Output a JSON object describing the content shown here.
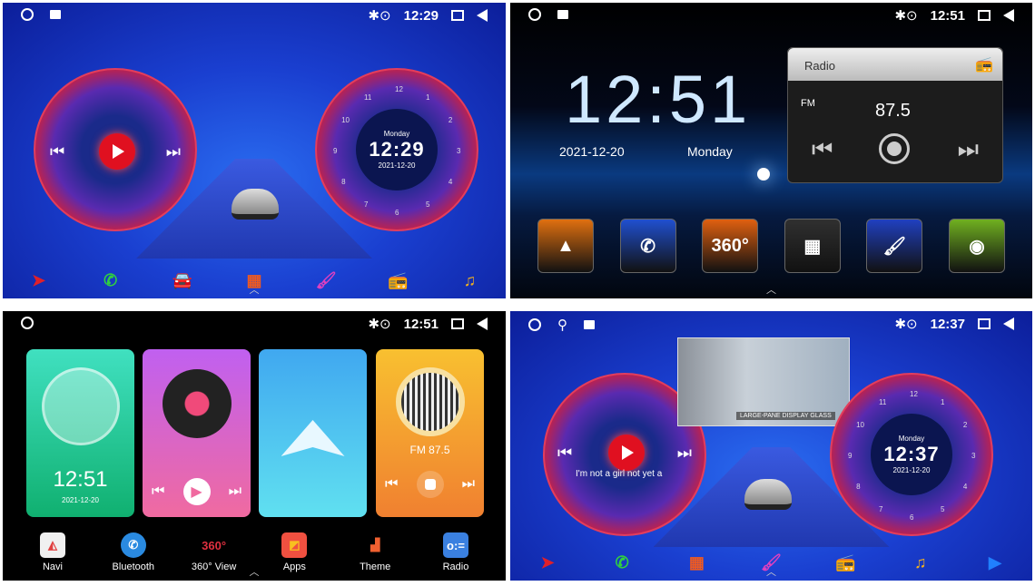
{
  "panel1": {
    "status": {
      "time": "12:29"
    },
    "clock": {
      "day": "Monday",
      "time": "12:29",
      "date": "2021-12-20",
      "dial": [
        "12",
        "1",
        "2",
        "3",
        "4",
        "5",
        "6",
        "7",
        "8",
        "9",
        "10",
        "11"
      ]
    },
    "dock": [
      {
        "icon": "navigation-arrow-icon",
        "color": "#e0202a",
        "glyph": "➤"
      },
      {
        "icon": "phone-icon",
        "color": "#30d040",
        "glyph": "✆"
      },
      {
        "icon": "car-360-icon",
        "color": "#f0a020",
        "glyph": "🚘"
      },
      {
        "icon": "apps-grid-icon",
        "color": "#f05a20",
        "glyph": "▦"
      },
      {
        "icon": "theme-brush-icon",
        "color": "#e040c0",
        "glyph": "🖌"
      },
      {
        "icon": "radio-icon",
        "color": "#40a0ff",
        "glyph": "📻"
      },
      {
        "icon": "music-note-icon",
        "color": "#f0b020",
        "glyph": "♫"
      }
    ]
  },
  "panel2": {
    "status": {
      "time": "12:51"
    },
    "clock": {
      "time": "12:51",
      "date": "2021-12-20",
      "day": "Monday"
    },
    "radio": {
      "title": "Radio",
      "band": "FM",
      "freq": "87.5"
    },
    "dock": [
      {
        "icon": "navigation-icon",
        "bg": "#e07010",
        "glyph": "▲"
      },
      {
        "icon": "bluetooth-phone-icon",
        "bg": "#2050d0",
        "glyph": "✆"
      },
      {
        "icon": "360-view-icon",
        "bg": "#e06010",
        "glyph": "360°"
      },
      {
        "icon": "apps-icon",
        "bg": "#303030",
        "glyph": "▦"
      },
      {
        "icon": "theme-icon",
        "bg": "#2040c0",
        "glyph": "🖌"
      },
      {
        "icon": "radio-signal-icon",
        "bg": "#70b020",
        "glyph": "◉"
      }
    ]
  },
  "panel3": {
    "status": {
      "time": "12:51"
    },
    "clock": {
      "time": "12:51",
      "date": "2021-12-20"
    },
    "radio": {
      "freq": "FM 87.5"
    },
    "dock": [
      {
        "label": "Navi",
        "icon": "navi-icon",
        "glyph": "◭",
        "bg": "#f0f0f0",
        "fg": "#e04040"
      },
      {
        "label": "Bluetooth",
        "icon": "bluetooth-icon",
        "glyph": "✆",
        "bg": "#2a8ae0",
        "fg": "#fff"
      },
      {
        "label": "360° View",
        "icon": "360-view-icon",
        "glyph": "360°",
        "bg": "transparent",
        "fg": "#e03040"
      },
      {
        "label": "Apps",
        "icon": "apps-icon",
        "glyph": "◩",
        "bg": "#f05040",
        "fg": "#f8c020"
      },
      {
        "label": "Theme",
        "icon": "theme-icon",
        "glyph": "▟",
        "bg": "transparent",
        "fg": "#f06030"
      },
      {
        "label": "Radio",
        "icon": "radio-icon",
        "glyph": "o:=",
        "bg": "#3a80e0",
        "fg": "#fff"
      }
    ]
  },
  "panel4": {
    "status": {
      "time": "12:37"
    },
    "clock": {
      "day": "Monday",
      "time": "12:37",
      "date": "2021-12-20",
      "dial": [
        "12",
        "1",
        "2",
        "3",
        "4",
        "5",
        "6",
        "7",
        "8",
        "9",
        "10",
        "11"
      ]
    },
    "lyrics": "I'm not a girl not yet a",
    "video_caption": "LARGE-PANE DISPLAY GLASS",
    "dock": [
      {
        "icon": "navigation-arrow-icon",
        "color": "#e0202a",
        "glyph": "➤"
      },
      {
        "icon": "phone-icon",
        "color": "#30d040",
        "glyph": "✆"
      },
      {
        "icon": "apps-grid-icon",
        "color": "#f05a20",
        "glyph": "▦"
      },
      {
        "icon": "theme-brush-icon",
        "color": "#e040c0",
        "glyph": "🖌"
      },
      {
        "icon": "radio-icon",
        "color": "#40a0ff",
        "glyph": "📻"
      },
      {
        "icon": "music-note-icon",
        "color": "#f0b020",
        "glyph": "♫"
      },
      {
        "icon": "video-play-icon",
        "color": "#2080ff",
        "glyph": "▶"
      }
    ]
  }
}
